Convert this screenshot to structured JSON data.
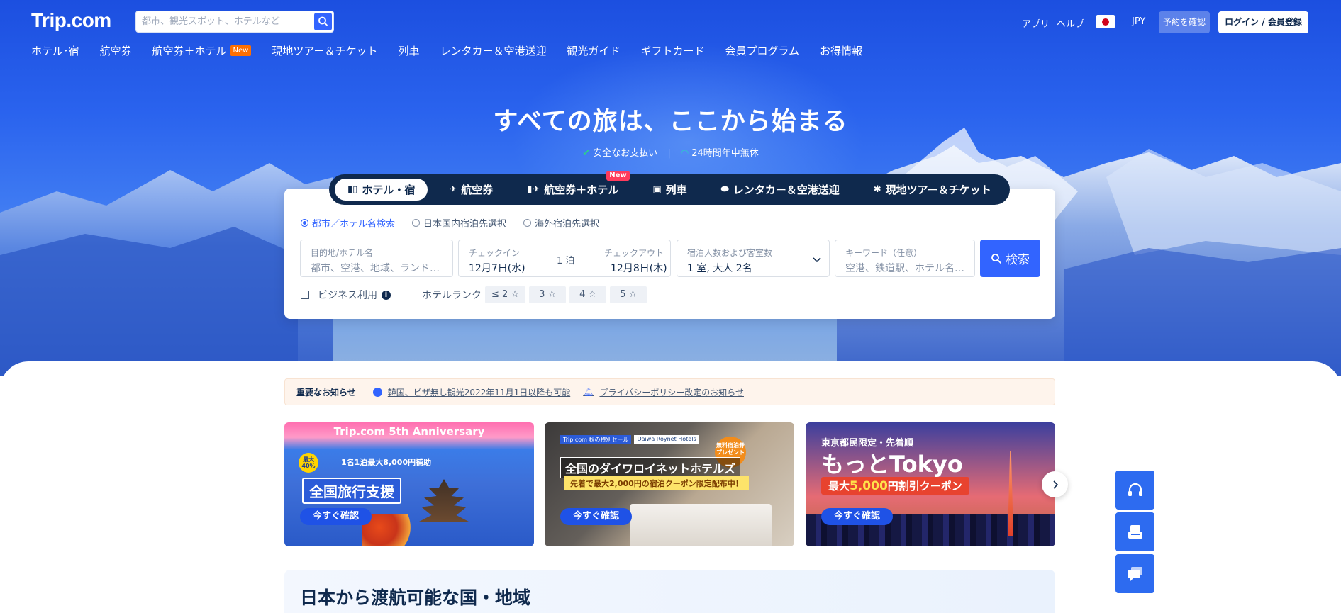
{
  "header": {
    "logo": "Trip.com",
    "search_placeholder": "都市、観光スポット、ホテルなど",
    "app": "アプリ",
    "help": "ヘルプ",
    "currency": "JPY",
    "confirm": "予約を確認",
    "login": "ログイン / 会員登録"
  },
  "nav": {
    "items": [
      "ホテル･宿",
      "航空券",
      "航空券＋ホテル",
      "現地ツアー＆チケット",
      "列車",
      "レンタカー＆空港送迎",
      "観光ガイド",
      "ギフトカード",
      "会員プログラム",
      "お得情報"
    ],
    "new_badge": "New"
  },
  "hero": {
    "title": "すべての旅は、ここから始まる",
    "secure": "安全なお支払い",
    "support": "24時間年中無休"
  },
  "search_tabs": {
    "items": [
      "ホテル・宿",
      "航空券",
      "航空券＋ホテル",
      "列車",
      "レンタカー＆空港送迎",
      "現地ツアー＆チケット"
    ],
    "new_tag": "New"
  },
  "search_form": {
    "radios": [
      "都市／ホテル名検索",
      "日本国内宿泊先選択",
      "海外宿泊先選択"
    ],
    "destination_label": "目的地/ホテル名",
    "destination_placeholder": "都市、空港、地域、ランド…",
    "checkin_label": "チェックイン",
    "checkin_value": "12月7日(水)",
    "nights": "1 泊",
    "checkout_label": "チェックアウト",
    "checkout_value": "12月8日(木)",
    "guests_label": "宿泊人数および客室数",
    "guests_value": "1 室, 大人 2名",
    "keyword_label": "キーワード（任意）",
    "keyword_placeholder": "空港、鉄道駅、ホテル名…",
    "search_button": "検索",
    "business": "ビジネス利用",
    "rank_label": "ホテルランク",
    "stars": [
      "≤ 2 ☆",
      "3 ☆",
      "4 ☆",
      "5 ☆"
    ]
  },
  "notice": {
    "title": "重要なお知らせ",
    "link1": "韓国、ビザ無し観光2022年11月1日以降も可能",
    "link2": "プライバシーポリシー改定のお知らせ"
  },
  "banners": [
    {
      "brand": "Trip.com 5th Anniversary",
      "circle": "最大40%",
      "sub": "1名1泊最大8,000円補助",
      "headline": "全国旅行支援",
      "button": "今すぐ確認"
    },
    {
      "tag1": "Trip.com 秋の特別セール",
      "tag2": "Daiwa Roynet Hotels",
      "circle": "無料宿泊券プレゼント",
      "headline": "全国のダイワロイネットホテルズ",
      "sub": "先着で最大2,000円の宿泊クーポン限定配布中！",
      "button": "今すぐ確認"
    },
    {
      "line1": "東京都民限定・先着順",
      "line2": "もっとTokyo",
      "coupon_prefix": "最大",
      "coupon_amount": "5,000",
      "coupon_suffix": "円割引クーポン",
      "button": "今すぐ確認"
    }
  ],
  "section": {
    "countries_title": "日本から渡航可能な国・地域"
  },
  "colors": {
    "accent": "#3264ff",
    "navy": "#0f294d",
    "new_badge": "#ff6f00"
  }
}
